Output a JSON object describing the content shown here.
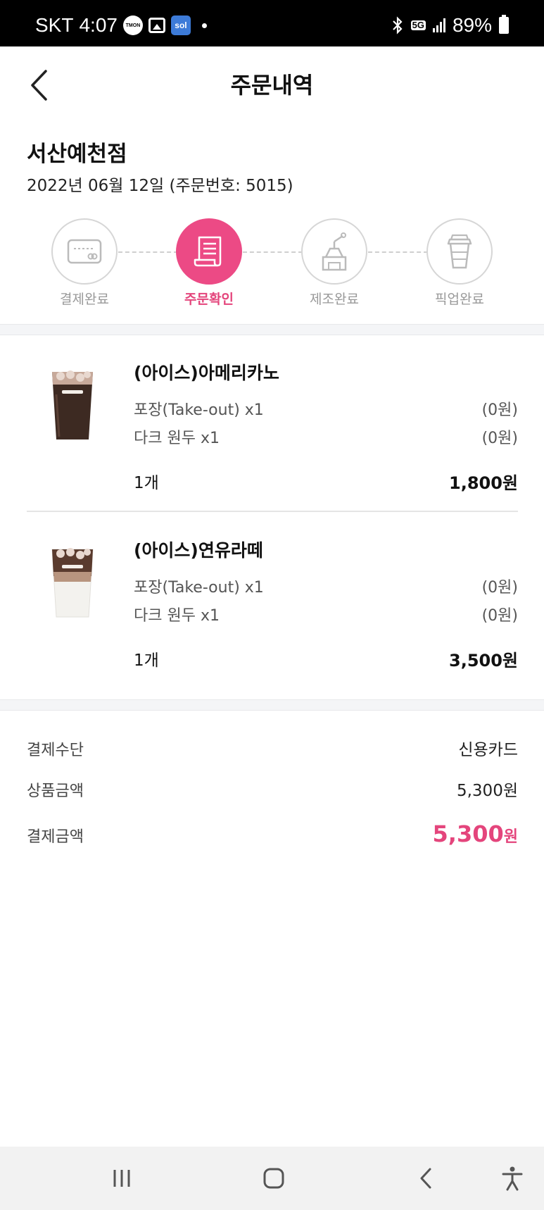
{
  "status_bar": {
    "carrier": "SKT",
    "time": "4:07",
    "tmon_label": "TMON",
    "sol_label": "sol",
    "network": "5G",
    "battery": "89%"
  },
  "header": {
    "title": "주문내역"
  },
  "store": {
    "name": "서산예천점",
    "order_info": "2022년 06월 12일 (주문번호: 5015)"
  },
  "steps": [
    {
      "label": "결제완료",
      "icon": "card-icon",
      "active": false
    },
    {
      "label": "주문확인",
      "icon": "receipt-icon",
      "active": true
    },
    {
      "label": "제조완료",
      "icon": "coffee-grinder-icon",
      "active": false
    },
    {
      "label": "픽업완료",
      "icon": "takeout-cup-icon",
      "active": false
    }
  ],
  "items": [
    {
      "name": "(아이스)아메리카노",
      "options": [
        {
          "label": "포장(Take-out) x1",
          "price": "(0원)"
        },
        {
          "label": "다크 원두 x1",
          "price": "(0원)"
        }
      ],
      "quantity": "1개",
      "price": "1,800원"
    },
    {
      "name": "(아이스)연유라떼",
      "options": [
        {
          "label": "포장(Take-out) x1",
          "price": "(0원)"
        },
        {
          "label": "다크 원두 x1",
          "price": "(0원)"
        }
      ],
      "quantity": "1개",
      "price": "3,500원"
    }
  ],
  "payment": {
    "method_label": "결제수단",
    "method_value": "신용카드",
    "subtotal_label": "상품금액",
    "subtotal_value": "5,300원",
    "total_label": "결제금액",
    "total_amount": "5,300",
    "total_unit": "원"
  },
  "colors": {
    "accent": "#ec4a85",
    "accent_text": "#e4457c"
  }
}
